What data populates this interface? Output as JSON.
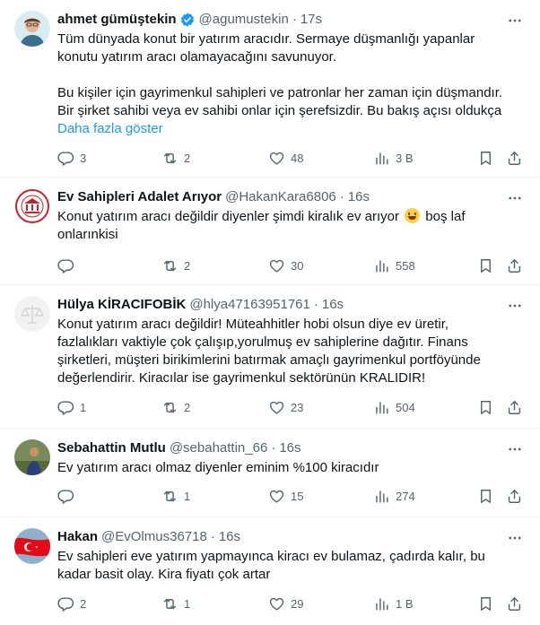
{
  "colors": {
    "link": "#1d9bf0",
    "verified": "#1d9bf0",
    "muted": "#536471",
    "text": "#0f1419"
  },
  "tweets": [
    {
      "name": "ahmet gümüştekin",
      "verified": true,
      "handle": "@agumustekin",
      "time": "17s",
      "paragraph1": "Tüm dünyada konut bir yatırım aracıdır. Sermaye düşmanlığı yapanlar\nkonutu yatırım aracı olamayacağını savunuyor.",
      "paragraph2": "Bu kişiler için gayrimenkul sahipleri ve patronlar her zaman için düşmandır.\nBir şirket sahibi veya ev sahibi onlar için şerefsizdir. Bu bakış açısı oldukça",
      "show_more": "Daha fazla göster",
      "replies": "3",
      "retweets": "2",
      "likes": "48",
      "views": "3 B"
    },
    {
      "name": "Ev Sahipleri Adalet Arıyor",
      "handle": "@HakanKara6806",
      "time": "16s",
      "text_before_emoji": "Konut yatırım aracı değildir diyenler şimdi kiralık ev arıyor ",
      "emoji": "grinning-sweat-emoji",
      "text_after_emoji": " boş laf\nonlarınkisi",
      "replies": "",
      "retweets": "2",
      "likes": "30",
      "views": "558"
    },
    {
      "name": "Hülya KİRACIFOBİK",
      "handle": "@hlya47163951761",
      "time": "16s",
      "text": "Konut yatırım aracı değildir! Müteahhitler hobi olsun diye ev üretir,\nfazlalıkları vaktiyle çok çalışıp,yorulmuş ev sahiplerine dağıtır. Finans\nşirketleri, müşteri birikimlerini batırmak amaçlı gayrimenkul portföyünde\ndeğerlendirir. Kiracılar ise gayrimenkul sektörünün KRALIDIR!",
      "replies": "1",
      "retweets": "2",
      "likes": "23",
      "views": "504"
    },
    {
      "name": "Sebahattin Mutlu",
      "handle": "@sebahattin_66",
      "time": "16s",
      "text": "Ev yatırım aracı olmaz diyenler eminim %100 kiracıdır",
      "replies": "",
      "retweets": "1",
      "likes": "15",
      "views": "274"
    },
    {
      "name": "Hakan",
      "handle": "@EvOlmus36718",
      "time": "16s",
      "text": "Ev sahipleri eve yatırım yapmayınca kiracı ev bulamaz, çadırda kalır, bu\nkadar basit olay. Kira fiyatı çok artar",
      "replies": "2",
      "retweets": "1",
      "likes": "29",
      "views": "1 B"
    }
  ],
  "icons": [
    "verified-badge-icon",
    "more-icon",
    "reply-icon",
    "retweet-icon",
    "like-icon",
    "views-icon",
    "bookmark-icon",
    "share-icon"
  ],
  "separator": "·"
}
